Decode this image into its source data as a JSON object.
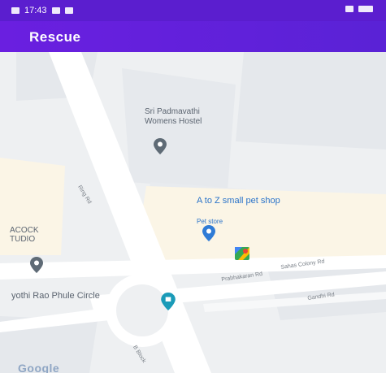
{
  "status_bar": {
    "time": "17:43"
  },
  "app_bar": {
    "title": "Rescue"
  },
  "map": {
    "places": {
      "hostel": "Sri Padmavathi\nWomens Hostel",
      "pet_shop": "A to Z small pet shop",
      "pet_shop_category": "Pet store",
      "studio": "ACOCK\nTUDIO",
      "circle": "yothi Rao Phule Circle"
    },
    "roads": {
      "a": "Ring Rd",
      "b": "Prabhakaran Rd",
      "c": "Sahas Colony Rd",
      "d": "Gandhi Rd",
      "e": "B Block"
    },
    "attribution": "Google"
  },
  "colors": {
    "status_bar": "#5b1ecf",
    "app_bar": "#6a1fe0",
    "pin_gray": "#5f6b76",
    "pin_blue": "#2f7bd6",
    "pin_teal": "#1a9bb8"
  }
}
